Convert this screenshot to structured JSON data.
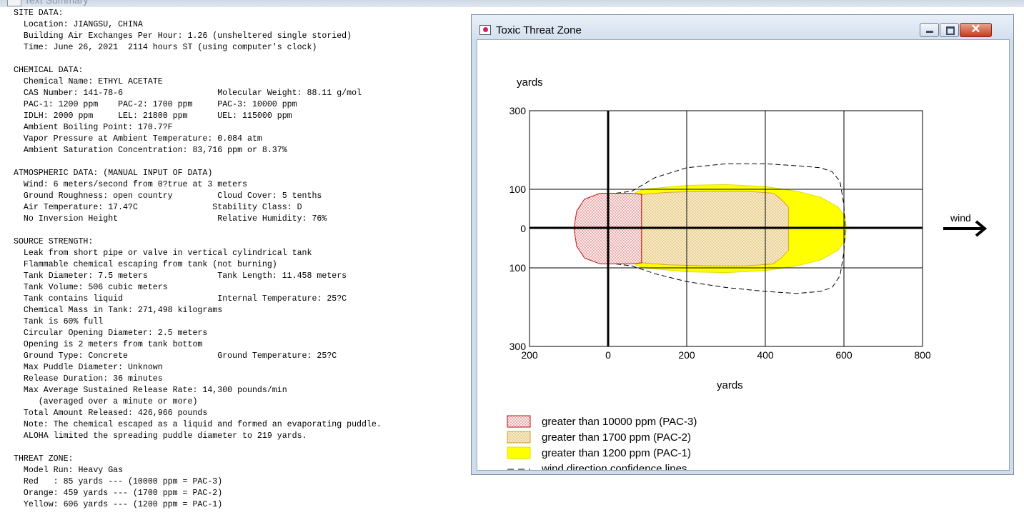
{
  "top_window": {
    "title": "Text Summary"
  },
  "summary_text": "SITE DATA:\n  Location: JIANGSU, CHINA\n  Building Air Exchanges Per Hour: 1.26 (unsheltered single storied)\n  Time: June 26, 2021  2114 hours ST (using computer's clock)\n\nCHEMICAL DATA:\n  Chemical Name: ETHYL ACETATE\n  CAS Number: 141-78-6                   Molecular Weight: 88.11 g/mol\n  PAC-1: 1200 ppm    PAC-2: 1700 ppm     PAC-3: 10000 ppm\n  IDLH: 2000 ppm     LEL: 21800 ppm      UEL: 115000 ppm\n  Ambient Boiling Point: 170.7?F\n  Vapor Pressure at Ambient Temperature: 0.084 atm\n  Ambient Saturation Concentration: 83,716 ppm or 8.37%\n\nATMOSPHERIC DATA: (MANUAL INPUT OF DATA)\n  Wind: 6 meters/second from 0?true at 3 meters\n  Ground Roughness: open country         Cloud Cover: 5 tenths\n  Air Temperature: 17.4?C               Stability Class: D\n  No Inversion Height                    Relative Humidity: 76%\n\nSOURCE STRENGTH:\n  Leak from short pipe or valve in vertical cylindrical tank\n  Flammable chemical escaping from tank (not burning)\n  Tank Diameter: 7.5 meters              Tank Length: 11.458 meters\n  Tank Volume: 506 cubic meters\n  Tank contains liquid                   Internal Temperature: 25?C\n  Chemical Mass in Tank: 271,498 kilograms\n  Tank is 60% full\n  Circular Opening Diameter: 2.5 meters\n  Opening is 2 meters from tank bottom\n  Ground Type: Concrete                  Ground Temperature: 25?C\n  Max Puddle Diameter: Unknown\n  Release Duration: 36 minutes\n  Max Average Sustained Release Rate: 14,300 pounds/min\n     (averaged over a minute or more)\n  Total Amount Released: 426,966 pounds\n  Note: The chemical escaped as a liquid and formed an evaporating puddle.\n  ALOHA limited the spreading puddle diameter to 219 yards.\n\nTHREAT ZONE:\n  Model Run: Heavy Gas\n  Red   : 85 yards --- (10000 ppm = PAC-3)\n  Orange: 459 yards --- (1700 ppm = PAC-2)\n  Yellow: 606 yards --- (1200 ppm = PAC-1)",
  "threat_window": {
    "title": "Toxic Threat Zone",
    "icons": {
      "app": "aloha-app-icon",
      "minimize": "minimize-icon",
      "maximize": "maximize-icon",
      "close": "close-icon"
    }
  },
  "chart_data": {
    "type": "area",
    "xlabel": "yards",
    "ylabel": "yards",
    "xlim": [
      -200,
      800
    ],
    "ylim": [
      -300,
      300
    ],
    "x_ticks": [
      "200",
      "0",
      "200",
      "400",
      "600",
      "800"
    ],
    "y_ticks": [
      "300",
      "100",
      "0",
      "100",
      "300"
    ],
    "grid": true,
    "wind_label": "wind",
    "zones": [
      {
        "name": "greater than 10000 ppm (PAC-3)",
        "color": "#ff0000",
        "fill": "dotted-red",
        "downwind_extent": 85,
        "outline": [
          [
            85,
            -87
          ],
          [
            85,
            87
          ],
          [
            60,
            90
          ],
          [
            -20,
            90
          ],
          [
            -60,
            75
          ],
          [
            -80,
            45
          ],
          [
            -87,
            0
          ],
          [
            -80,
            -45
          ],
          [
            -60,
            -75
          ],
          [
            -20,
            -90
          ],
          [
            60,
            -90
          ]
        ]
      },
      {
        "name": "greater than 1700 ppm (PAC-2)",
        "color": "#d7a33b",
        "fill": "dotted-orange",
        "downwind_extent": 459,
        "outline": [
          [
            85,
            -87
          ],
          [
            85,
            87
          ],
          [
            150,
            92
          ],
          [
            250,
            95
          ],
          [
            350,
            95
          ],
          [
            420,
            90
          ],
          [
            440,
            75
          ],
          [
            459,
            55
          ],
          [
            459,
            -55
          ],
          [
            440,
            -75
          ],
          [
            420,
            -90
          ],
          [
            350,
            -95
          ],
          [
            250,
            -95
          ],
          [
            150,
            -92
          ]
        ]
      },
      {
        "name": "greater than 1200 ppm (PAC-1)",
        "color": "#ffff00",
        "fill": "solid-yellow",
        "downwind_extent": 606,
        "outline": [
          [
            70,
            -92
          ],
          [
            90,
            -100
          ],
          [
            200,
            -110
          ],
          [
            300,
            -112
          ],
          [
            400,
            -107
          ],
          [
            480,
            -95
          ],
          [
            540,
            -80
          ],
          [
            585,
            -55
          ],
          [
            603,
            -30
          ],
          [
            606,
            0
          ],
          [
            603,
            30
          ],
          [
            585,
            55
          ],
          [
            540,
            80
          ],
          [
            480,
            95
          ],
          [
            400,
            107
          ],
          [
            300,
            112
          ],
          [
            200,
            110
          ],
          [
            90,
            100
          ],
          [
            70,
            92
          ]
        ]
      }
    ],
    "confidence_lines": {
      "name": "wind direction confidence lines",
      "upper": [
        [
          20,
          -90
        ],
        [
          60,
          -95
        ],
        [
          120,
          -130
        ],
        [
          200,
          -155
        ],
        [
          300,
          -165
        ],
        [
          400,
          -165
        ],
        [
          480,
          -160
        ],
        [
          540,
          -155
        ],
        [
          570,
          -145
        ],
        [
          590,
          -120
        ],
        [
          600,
          -60
        ],
        [
          603,
          0
        ]
      ],
      "lower": [
        [
          20,
          90
        ],
        [
          60,
          95
        ],
        [
          120,
          115
        ],
        [
          200,
          135
        ],
        [
          300,
          150
        ],
        [
          400,
          160
        ],
        [
          480,
          165
        ],
        [
          540,
          160
        ],
        [
          570,
          150
        ],
        [
          590,
          120
        ],
        [
          600,
          60
        ],
        [
          603,
          0
        ]
      ]
    },
    "legend": [
      {
        "label": "greater than 10000 ppm (PAC-3)",
        "swatch": "dotted-red"
      },
      {
        "label": "greater than 1700 ppm (PAC-2)",
        "swatch": "dotted-orange"
      },
      {
        "label": "greater than 1200 ppm (PAC-1)",
        "swatch": "solid-yellow"
      },
      {
        "label": "wind direction confidence lines",
        "swatch": "dashed-line"
      }
    ],
    "legend_position": "bottom-left"
  }
}
